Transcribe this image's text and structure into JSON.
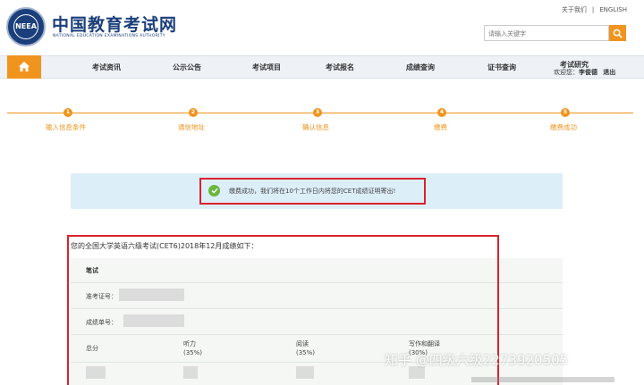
{
  "header": {
    "logo_title": "中国教育考试网",
    "logo_subtitle": "NATIONAL EDUCATION EXAMINATIONS AUTHORITY",
    "logo_seal_text": "NEEA",
    "top_links": [
      "关于我们",
      "|",
      "ENGLISH"
    ],
    "search": {
      "placeholder": "请输入关键字",
      "icon": "search-icon"
    },
    "accent_color": "#f0941e",
    "brand_color": "#1b3f7a"
  },
  "nav": {
    "home_icon": "home-icon",
    "items": [
      "考试资讯",
      "公示公告",
      "考试项目",
      "考试报名",
      "成绩查询",
      "证书查询",
      "考试研究"
    ],
    "user": {
      "greeting": "欢迎您：",
      "name": "李俊德",
      "logout": "退出"
    }
  },
  "steps": [
    {
      "num": "1",
      "label": "输入信息条件"
    },
    {
      "num": "2",
      "label": "通信地址"
    },
    {
      "num": "3",
      "label": "确认信息"
    },
    {
      "num": "4",
      "label": "缴费"
    },
    {
      "num": "5",
      "label": "缴费成功"
    }
  ],
  "banner": {
    "icon": "check-circle-icon",
    "message": "缴费成功，我们将在10个工作日内将您的CET成绩证明寄出!",
    "highlight_color": "#d9232d"
  },
  "scores": {
    "title": "您的全国大学英语六级考试(CET6)2018年12月成绩如下：",
    "section": "笔试",
    "ticket_label": "准考证号：",
    "report_label": "成绩单号：",
    "columns": [
      "总分",
      "听力",
      "阅读",
      "写作和翻译"
    ],
    "weights": [
      "",
      "(35%)",
      "(35%)",
      "(30%)"
    ]
  },
  "watermark": {
    "text": "知乎 @四级六级2273920505"
  }
}
